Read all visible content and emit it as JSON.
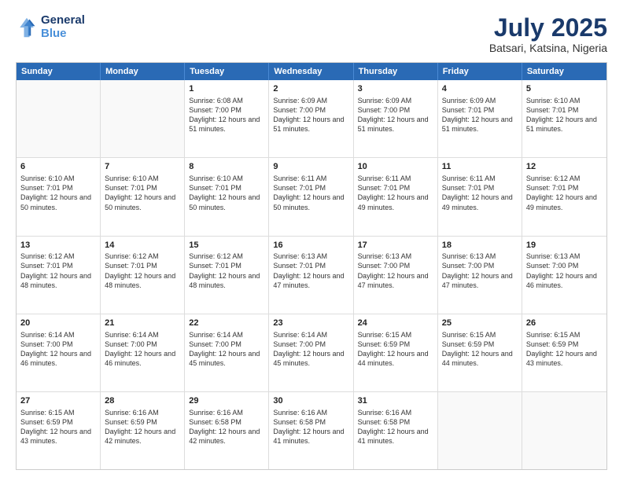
{
  "logo": {
    "line1": "General",
    "line2": "Blue"
  },
  "title": "July 2025",
  "location": "Batsari, Katsina, Nigeria",
  "weekdays": [
    "Sunday",
    "Monday",
    "Tuesday",
    "Wednesday",
    "Thursday",
    "Friday",
    "Saturday"
  ],
  "weeks": [
    [
      {
        "day": "",
        "info": ""
      },
      {
        "day": "",
        "info": ""
      },
      {
        "day": "1",
        "info": "Sunrise: 6:08 AM\nSunset: 7:00 PM\nDaylight: 12 hours and 51 minutes."
      },
      {
        "day": "2",
        "info": "Sunrise: 6:09 AM\nSunset: 7:00 PM\nDaylight: 12 hours and 51 minutes."
      },
      {
        "day": "3",
        "info": "Sunrise: 6:09 AM\nSunset: 7:00 PM\nDaylight: 12 hours and 51 minutes."
      },
      {
        "day": "4",
        "info": "Sunrise: 6:09 AM\nSunset: 7:01 PM\nDaylight: 12 hours and 51 minutes."
      },
      {
        "day": "5",
        "info": "Sunrise: 6:10 AM\nSunset: 7:01 PM\nDaylight: 12 hours and 51 minutes."
      }
    ],
    [
      {
        "day": "6",
        "info": "Sunrise: 6:10 AM\nSunset: 7:01 PM\nDaylight: 12 hours and 50 minutes."
      },
      {
        "day": "7",
        "info": "Sunrise: 6:10 AM\nSunset: 7:01 PM\nDaylight: 12 hours and 50 minutes."
      },
      {
        "day": "8",
        "info": "Sunrise: 6:10 AM\nSunset: 7:01 PM\nDaylight: 12 hours and 50 minutes."
      },
      {
        "day": "9",
        "info": "Sunrise: 6:11 AM\nSunset: 7:01 PM\nDaylight: 12 hours and 50 minutes."
      },
      {
        "day": "10",
        "info": "Sunrise: 6:11 AM\nSunset: 7:01 PM\nDaylight: 12 hours and 49 minutes."
      },
      {
        "day": "11",
        "info": "Sunrise: 6:11 AM\nSunset: 7:01 PM\nDaylight: 12 hours and 49 minutes."
      },
      {
        "day": "12",
        "info": "Sunrise: 6:12 AM\nSunset: 7:01 PM\nDaylight: 12 hours and 49 minutes."
      }
    ],
    [
      {
        "day": "13",
        "info": "Sunrise: 6:12 AM\nSunset: 7:01 PM\nDaylight: 12 hours and 48 minutes."
      },
      {
        "day": "14",
        "info": "Sunrise: 6:12 AM\nSunset: 7:01 PM\nDaylight: 12 hours and 48 minutes."
      },
      {
        "day": "15",
        "info": "Sunrise: 6:12 AM\nSunset: 7:01 PM\nDaylight: 12 hours and 48 minutes."
      },
      {
        "day": "16",
        "info": "Sunrise: 6:13 AM\nSunset: 7:01 PM\nDaylight: 12 hours and 47 minutes."
      },
      {
        "day": "17",
        "info": "Sunrise: 6:13 AM\nSunset: 7:00 PM\nDaylight: 12 hours and 47 minutes."
      },
      {
        "day": "18",
        "info": "Sunrise: 6:13 AM\nSunset: 7:00 PM\nDaylight: 12 hours and 47 minutes."
      },
      {
        "day": "19",
        "info": "Sunrise: 6:13 AM\nSunset: 7:00 PM\nDaylight: 12 hours and 46 minutes."
      }
    ],
    [
      {
        "day": "20",
        "info": "Sunrise: 6:14 AM\nSunset: 7:00 PM\nDaylight: 12 hours and 46 minutes."
      },
      {
        "day": "21",
        "info": "Sunrise: 6:14 AM\nSunset: 7:00 PM\nDaylight: 12 hours and 46 minutes."
      },
      {
        "day": "22",
        "info": "Sunrise: 6:14 AM\nSunset: 7:00 PM\nDaylight: 12 hours and 45 minutes."
      },
      {
        "day": "23",
        "info": "Sunrise: 6:14 AM\nSunset: 7:00 PM\nDaylight: 12 hours and 45 minutes."
      },
      {
        "day": "24",
        "info": "Sunrise: 6:15 AM\nSunset: 6:59 PM\nDaylight: 12 hours and 44 minutes."
      },
      {
        "day": "25",
        "info": "Sunrise: 6:15 AM\nSunset: 6:59 PM\nDaylight: 12 hours and 44 minutes."
      },
      {
        "day": "26",
        "info": "Sunrise: 6:15 AM\nSunset: 6:59 PM\nDaylight: 12 hours and 43 minutes."
      }
    ],
    [
      {
        "day": "27",
        "info": "Sunrise: 6:15 AM\nSunset: 6:59 PM\nDaylight: 12 hours and 43 minutes."
      },
      {
        "day": "28",
        "info": "Sunrise: 6:16 AM\nSunset: 6:59 PM\nDaylight: 12 hours and 42 minutes."
      },
      {
        "day": "29",
        "info": "Sunrise: 6:16 AM\nSunset: 6:58 PM\nDaylight: 12 hours and 42 minutes."
      },
      {
        "day": "30",
        "info": "Sunrise: 6:16 AM\nSunset: 6:58 PM\nDaylight: 12 hours and 41 minutes."
      },
      {
        "day": "31",
        "info": "Sunrise: 6:16 AM\nSunset: 6:58 PM\nDaylight: 12 hours and 41 minutes."
      },
      {
        "day": "",
        "info": ""
      },
      {
        "day": "",
        "info": ""
      }
    ]
  ]
}
